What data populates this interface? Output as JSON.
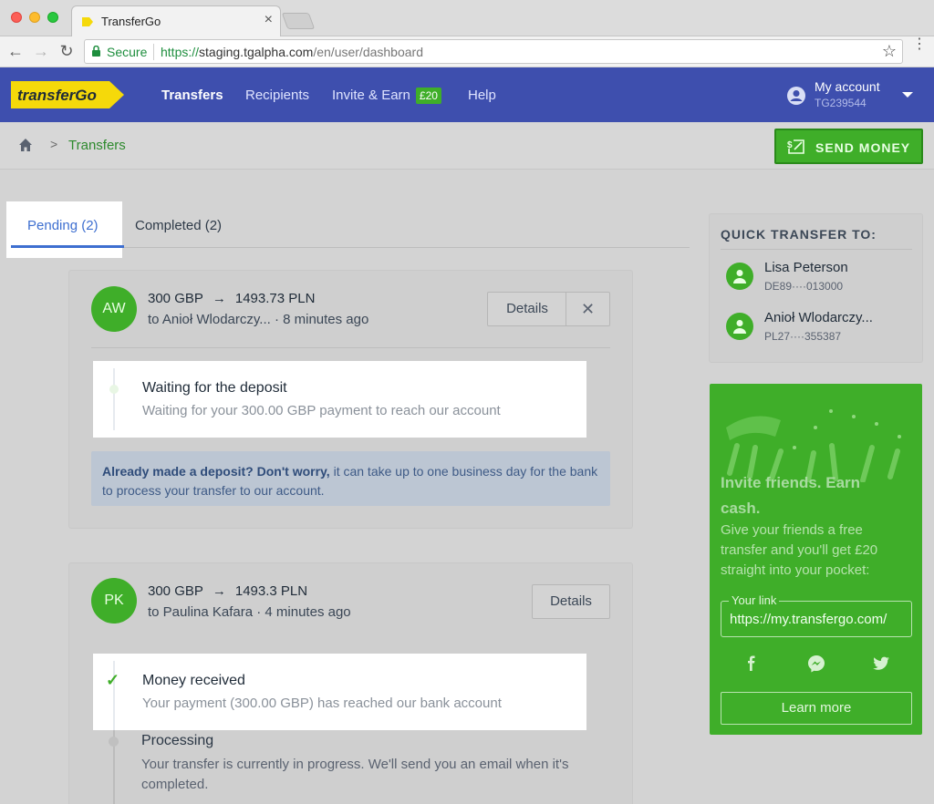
{
  "browser": {
    "tab_title": "TransferGo",
    "secure_label": "Secure",
    "url_scheme": "https://",
    "url_host": "staging.tgalpha.com",
    "url_path": "/en/user/dashboard"
  },
  "header": {
    "logo_text": "transferGo",
    "nav": [
      {
        "label": "Transfers",
        "active": true
      },
      {
        "label": "Recipients"
      },
      {
        "label": "Invite & Earn",
        "badge": "£20"
      },
      {
        "label": "Help"
      }
    ],
    "account_label": "My account",
    "account_id": "TG239544"
  },
  "breadcrumb": {
    "current": "Transfers"
  },
  "send_money_label": "SEND MONEY",
  "tabs": {
    "pending": "Pending (2)",
    "completed": "Completed (2)"
  },
  "transfers": [
    {
      "initials": "AW",
      "send_amount": "300 GBP",
      "arrow": "→",
      "receive_amount": "1493.73 PLN",
      "to_line": "to Anioł Wlodarczy... · 8 minutes ago",
      "details_label": "Details",
      "close_glyph": "✕",
      "status_title": "Waiting for the deposit",
      "status_sub": "Waiting for your 300.00 GBP payment to reach our account",
      "info_bold": "Already made a deposit? Don't worry,",
      "info_rest": " it can take up to one business day for the bank to process your transfer to our account."
    },
    {
      "initials": "PK",
      "send_amount": "300 GBP",
      "arrow": "→",
      "receive_amount": "1493.3 PLN",
      "to_line": "to Paulina Kafara · 4 minutes ago",
      "details_label": "Details",
      "status_title": "Money received",
      "status_sub": "Your payment (300.00 GBP) has reached our bank account",
      "check_glyph": "✓",
      "next_title": "Processing",
      "next_sub": "Your transfer is currently in progress. We'll send you an email when it's completed."
    }
  ],
  "quick_transfer": {
    "title": "QUICK TRANSFER TO:",
    "recipients": [
      {
        "name": "Lisa Peterson",
        "account": "DE89····013000"
      },
      {
        "name": "Anioł Wlodarczy...",
        "account": "PL27····355387"
      }
    ]
  },
  "promo": {
    "title": "Invite friends. Earn cash.",
    "text": "Give your friends a free transfer and you'll get £20 straight into your pocket:",
    "link_label": "Your link",
    "link_value": "https://my.transfergo.com/",
    "learn_more": "Learn more"
  },
  "colors": {
    "brand_blue": "#3e4fae",
    "brand_green": "#3fae29",
    "logo_yellow": "#f5d90a",
    "tab_blue": "#3e6fd0"
  }
}
